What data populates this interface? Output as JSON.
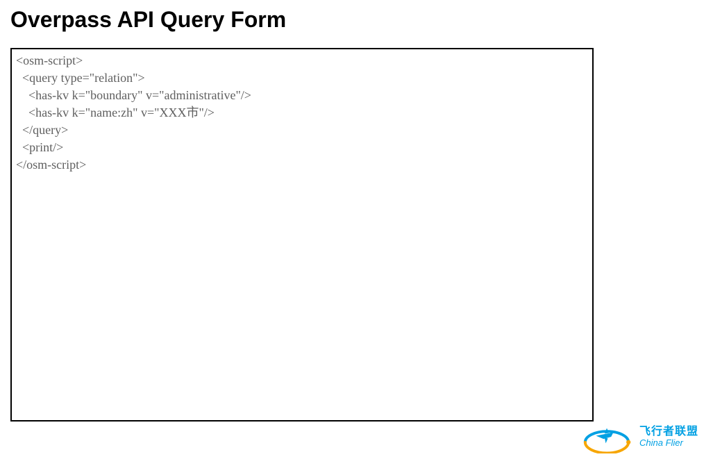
{
  "page": {
    "title": "Overpass API Query Form"
  },
  "query": {
    "value": "<osm-script>\n  <query type=\"relation\">\n    <has-kv k=\"boundary\" v=\"administrative\"/>\n    <has-kv k=\"name:zh\" v=\"XXX市\"/>\n  </query>\n  <print/>\n</osm-script>"
  },
  "watermark": {
    "line1": "飞行者联盟",
    "line2": "China Flier"
  }
}
